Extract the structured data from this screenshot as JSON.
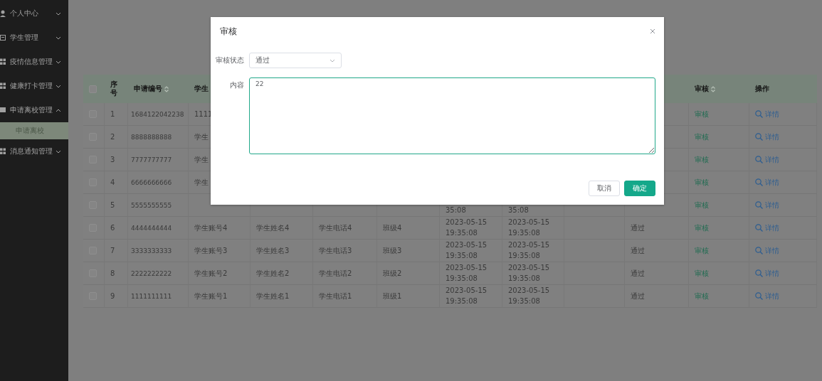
{
  "sidebar": {
    "items": [
      {
        "label": "个人中心",
        "expanded": false
      },
      {
        "label": "学生管理",
        "expanded": false
      },
      {
        "label": "疫情信息管理",
        "expanded": false
      },
      {
        "label": "健康打卡管理",
        "expanded": false
      },
      {
        "label": "申请离校管理",
        "expanded": true,
        "children": [
          {
            "label": "申请离校",
            "selected": true
          }
        ]
      },
      {
        "label": "消息通知管理",
        "expanded": false
      }
    ]
  },
  "table": {
    "columns": [
      {
        "kind": "checkbox",
        "checked": false
      },
      {
        "kind": "text",
        "label": "序号",
        "sortable": false
      },
      {
        "kind": "text",
        "label": "申请编号",
        "sortable": true
      },
      {
        "kind": "text",
        "label": "学生"
      },
      {
        "kind": "blank"
      },
      {
        "kind": "blank"
      },
      {
        "kind": "blank"
      },
      {
        "kind": "blank"
      },
      {
        "kind": "blank"
      },
      {
        "kind": "blank"
      },
      {
        "kind": "blank"
      },
      {
        "kind": "text",
        "label": "审核",
        "sortable": true
      },
      {
        "kind": "text",
        "label": "操作",
        "sortable": false
      }
    ],
    "rows": [
      {
        "checked": false,
        "seq": "1",
        "application_no": "1684122042238",
        "student_account": "1111",
        "audit": "审核",
        "detail": "详情"
      },
      {
        "checked": false,
        "seq": "2",
        "application_no": "8888888888",
        "student_account": "学生",
        "audit": "审核",
        "detail": "详情"
      },
      {
        "checked": false,
        "seq": "3",
        "application_no": "7777777777",
        "student_account": "学生",
        "audit": "审核",
        "detail": "详情"
      },
      {
        "checked": false,
        "seq": "4",
        "application_no": "6666666666",
        "student_account": "学生",
        "audit": "审核",
        "detail": "详情"
      },
      {
        "checked": false,
        "seq": "5",
        "application_no": "5555555555",
        "time_1": "35:08",
        "time_2": "35:08",
        "audit": "审核",
        "detail": "详情"
      },
      {
        "checked": false,
        "seq": "6",
        "application_no": "4444444444",
        "student_account": "学生账号4",
        "student_name": "学生姓名4",
        "student_phone": "学生电话4",
        "class": "班级4",
        "time_1": "2023-05-15 19:35:08",
        "time_2": "2023-05-15 19:35:08",
        "status": "通过",
        "audit": "审核",
        "detail": "详情"
      },
      {
        "checked": false,
        "seq": "7",
        "application_no": "3333333333",
        "student_account": "学生账号3",
        "student_name": "学生姓名3",
        "student_phone": "学生电话3",
        "class": "班级3",
        "time_1": "2023-05-15 19:35:08",
        "time_2": "2023-05-15 19:35:08",
        "status": "通过",
        "audit": "审核",
        "detail": "详情"
      },
      {
        "checked": false,
        "seq": "8",
        "application_no": "2222222222",
        "student_account": "学生账号2",
        "student_name": "学生姓名2",
        "student_phone": "学生电话2",
        "class": "班级2",
        "time_1": "2023-05-15 19:35:08",
        "time_2": "2023-05-15 19:35:08",
        "status": "通过",
        "audit": "审核",
        "detail": "详情"
      },
      {
        "checked": false,
        "seq": "9",
        "application_no": "1111111111",
        "student_account": "学生账号1",
        "student_name": "学生姓名1",
        "student_phone": "学生电话1",
        "class": "班级1",
        "time_1": "2023-05-15 19:35:08",
        "time_2": "2023-05-15 19:35:08",
        "status": "通过",
        "audit": "审核",
        "detail": "详情"
      }
    ]
  },
  "dialog": {
    "title": "审核",
    "fields": [
      {
        "kind": "select",
        "label": "审核状态",
        "value": "通过"
      },
      {
        "kind": "textarea",
        "label": "内容",
        "value": "22"
      }
    ],
    "buttons": [
      {
        "label": "取消",
        "kind": "default"
      },
      {
        "label": "确定",
        "kind": "primary"
      }
    ]
  }
}
